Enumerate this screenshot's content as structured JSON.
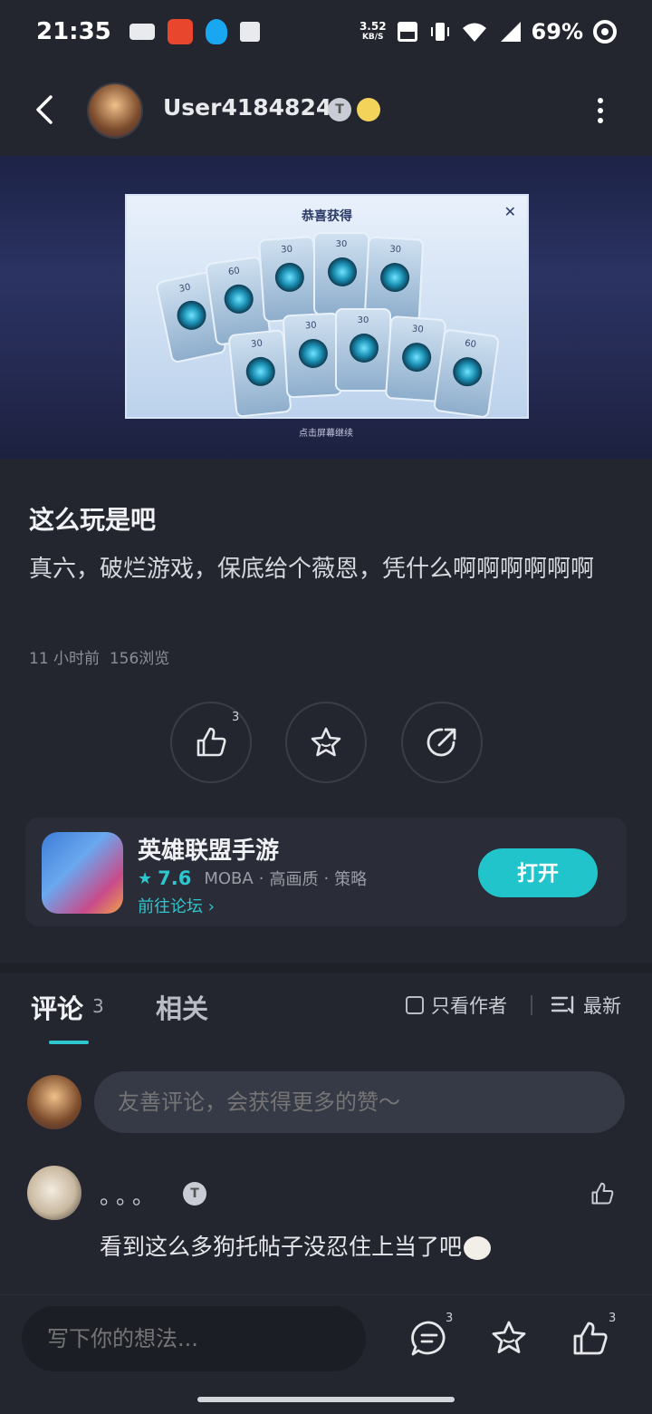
{
  "status_bar": {
    "time": "21:35",
    "speed_value": "3.52",
    "speed_unit": "KB/S",
    "battery": "69%"
  },
  "header": {
    "username": "User41848246",
    "badge": "T",
    "icons": [
      "back-arrow-icon",
      "more-vertical-icon"
    ]
  },
  "banner": {
    "dialog_title": "恭喜获得",
    "hint": "点击屏幕继续",
    "card_values": [
      "30",
      "60",
      "30",
      "30",
      "30",
      "30",
      "30",
      "30",
      "30",
      "60"
    ]
  },
  "post": {
    "title": "这么玩是吧",
    "body": "真六，破烂游戏，保底给个薇恩，凭什么啊啊啊啊啊啊",
    "time_ago": "11 小时前",
    "views": "156浏览",
    "like_count": "3"
  },
  "game": {
    "name": "英雄联盟手游",
    "rating": "7.6",
    "tags": [
      "MOBA",
      "高画质",
      "策略"
    ],
    "forum_link": "前往论坛",
    "open_label": "打开",
    "accent_color": "#22c4cc"
  },
  "comments_section": {
    "tab_comments": "评论",
    "comment_count": "3",
    "tab_related": "相关",
    "only_author": "只看作者",
    "sort_label": "最新",
    "input_placeholder": "友善评论，会获得更多的赞～"
  },
  "comments": [
    {
      "name": "。。。",
      "badge": "T",
      "text": "看到这么多狗托帖子没忍住上当了吧"
    }
  ],
  "bottom_bar": {
    "write_placeholder": "写下你的想法...",
    "comment_count": "3",
    "like_count": "3"
  }
}
